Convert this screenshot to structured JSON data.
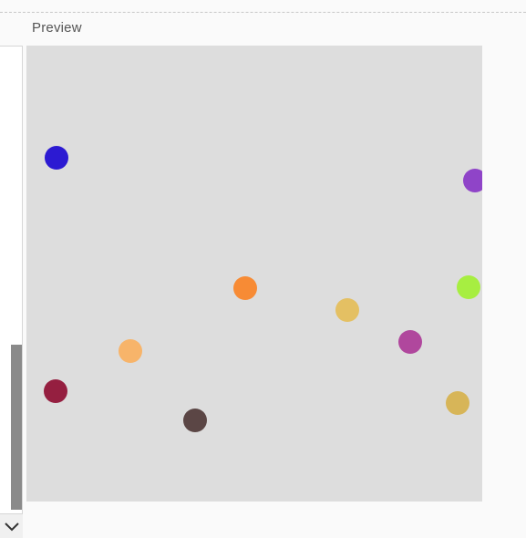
{
  "panel": {
    "title": "Preview"
  },
  "icons": {
    "scroll_down": "chevron-down-icon"
  },
  "canvas": {
    "background": "#dddddd",
    "dots": [
      {
        "color": "#2c1ad2"
      },
      {
        "color": "#8f44c8"
      },
      {
        "color": "#f78b35"
      },
      {
        "color": "#e4c063"
      },
      {
        "color": "#a7ee41"
      },
      {
        "color": "#f7b46a"
      },
      {
        "color": "#b0479d"
      },
      {
        "color": "#951f40"
      },
      {
        "color": "#5b4645"
      },
      {
        "color": "#d7b558"
      }
    ]
  }
}
